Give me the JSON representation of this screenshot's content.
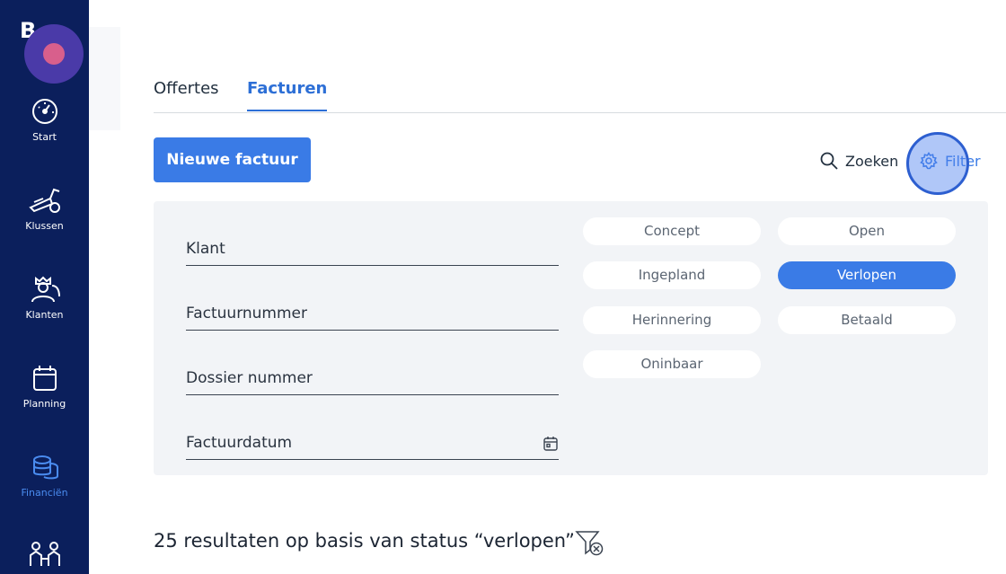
{
  "sidebar": {
    "brand": "B",
    "items": [
      {
        "label": "Start",
        "icon": "gauge-icon"
      },
      {
        "label": "Klussen",
        "icon": "tools-icon"
      },
      {
        "label": "Klanten",
        "icon": "customers-icon"
      },
      {
        "label": "Planning",
        "icon": "calendar-icon"
      },
      {
        "label": "Financiën",
        "icon": "coins-icon",
        "active": true
      },
      {
        "label": "",
        "icon": "team-icon"
      }
    ]
  },
  "tabs": [
    {
      "label": "Offertes"
    },
    {
      "label": "Facturen",
      "active": true
    }
  ],
  "toolbar": {
    "new_invoice_label": "Nieuwe factuur",
    "search_label": "Zoeken",
    "filter_label": "Filter"
  },
  "filters": {
    "fields": [
      {
        "label": "Klant"
      },
      {
        "label": "Factuurnummer"
      },
      {
        "label": "Dossier nummer"
      },
      {
        "label": "Factuurdatum"
      }
    ],
    "statuses": [
      {
        "label": "Concept",
        "selected": false
      },
      {
        "label": "Open",
        "selected": false
      },
      {
        "label": "Ingepland",
        "selected": false
      },
      {
        "label": "Verlopen",
        "selected": true
      },
      {
        "label": "Herinnering",
        "selected": false
      },
      {
        "label": "Betaald",
        "selected": false
      },
      {
        "label": "Oninbaar",
        "selected": false
      }
    ]
  },
  "results": {
    "text": "25 resultaten op basis van status “verlopen”"
  },
  "colors": {
    "sidebar": "#0b1f5c",
    "accent": "#3a7be6",
    "panel": "#f2f4f7"
  }
}
